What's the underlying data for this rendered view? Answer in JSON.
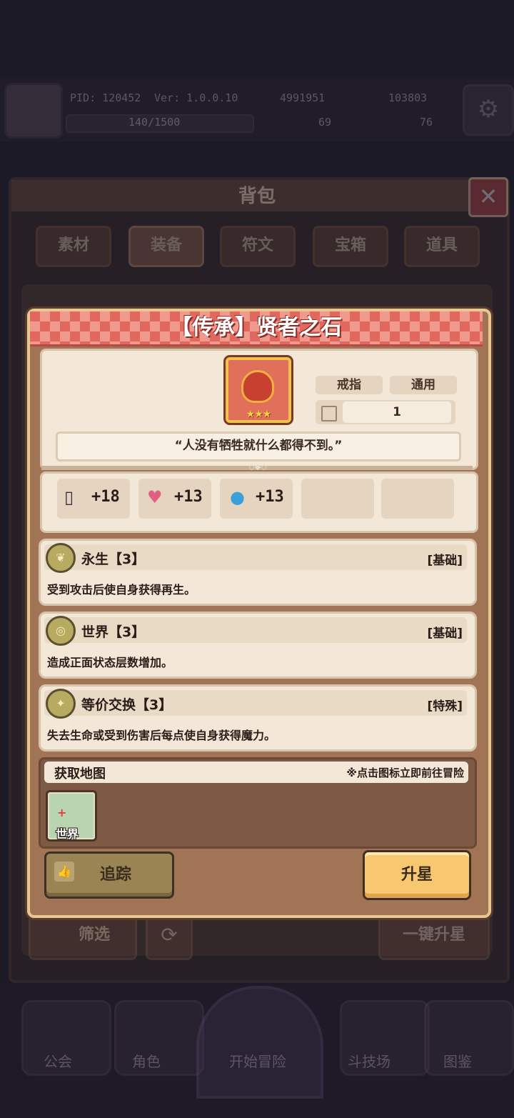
{
  "hud": {
    "pid": "PID: 120452",
    "version": "Ver: 1.0.0.10",
    "gold": "4991951",
    "gems": "103803",
    "exp": "140/1500",
    "clover": "69",
    "keys": "76"
  },
  "bag": {
    "title": "背包",
    "tabs": [
      "素材",
      "装备",
      "符文",
      "宝箱",
      "道具"
    ],
    "filter_label": "筛选",
    "one_key_star_label": "一键升星"
  },
  "bottom_nav": [
    "公会",
    "角色",
    "开始冒险",
    "斗技场",
    "图鉴"
  ],
  "item": {
    "title": "【传承】贤者之石",
    "stars": "★★★",
    "tag_slot": "戒指",
    "tag_class": "通用",
    "count": "1",
    "quote": "“人没有牺牲就什么都得不到。”",
    "stats": [
      {
        "icon": "book-icon",
        "glyph": "📖",
        "value": "+18"
      },
      {
        "icon": "heart-icon",
        "glyph": "♥",
        "value": "+13"
      },
      {
        "icon": "water-drop-icon",
        "glyph": "💧",
        "value": "+13"
      }
    ],
    "skills": [
      {
        "name": "永生【3】",
        "type": "[基础]",
        "desc": "受到攻击后使自身获得再生。"
      },
      {
        "name": "世界【3】",
        "type": "[基础]",
        "desc": "造成正面状态层数增加。"
      },
      {
        "name": "等价交换【3】",
        "type": "[特殊]",
        "desc": "失去生命或受到伤害后每点使自身获得魔力。"
      }
    ],
    "map_title": "获取地图",
    "map_hint": "※点击图标立即前往冒险",
    "map_tile_label": "世界",
    "track_label": "追踪",
    "star_up_label": "升星"
  },
  "colors": {
    "header_red": "#e0685e",
    "card_cream": "#f3e7d7",
    "star_button": "#f8c870",
    "track_button": "#9a8454"
  }
}
